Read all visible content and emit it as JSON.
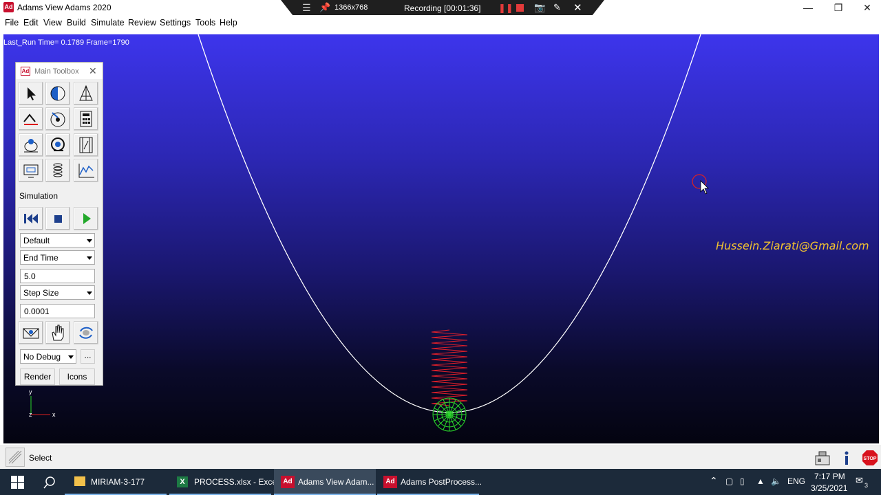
{
  "window": {
    "title": "Adams View Adams 2020",
    "app_icon": "Ad",
    "controls": [
      "minimize-icon",
      "restore-icon",
      "close-icon"
    ]
  },
  "recorder": {
    "resolution": "1366x768",
    "status": "Recording [00:01:36]"
  },
  "menu": [
    "File",
    "Edit",
    "View",
    "Build",
    "Simulate",
    "Review",
    "Settings",
    "Tools",
    "Help"
  ],
  "viewport": {
    "run_info": "Last_Run   Time= 0.1789  Frame=1790",
    "watermark": "Hussein.Ziarati@Gmail.com",
    "axis_y": "y",
    "axis_x": "x",
    "axis_z": "z",
    "colors": {
      "track": "#ffffff",
      "spring": "#e0202a",
      "ball": "#2ad82a",
      "bg_top": "#3d35ec",
      "bg_bottom": "#040410"
    }
  },
  "toolbox": {
    "title": "Main Toolbox",
    "app_icon": "Ad",
    "tools": [
      "select-arrow-icon",
      "rendering-sphere-icon",
      "part-geometry-icon",
      "joint-icon",
      "orient-view-icon",
      "calculator-icon",
      "force-icon",
      "display-settings-icon",
      "animation-film-icon",
      "monitor-icon",
      "spring-icon",
      "plot-icon"
    ],
    "simulation_label": "Simulation",
    "sim_buttons": [
      "reset-icon",
      "stop-icon",
      "play-icon"
    ],
    "sim_setting": "Default",
    "end_mode": "End Time",
    "end_value": "5.0",
    "step_mode": "Step Size",
    "step_value": "0.0001",
    "view_tools": [
      "fit-view-icon",
      "pan-hand-icon",
      "rotate-view-icon"
    ],
    "debug": "No Debug",
    "more": "...",
    "render_label": "Render",
    "icons_label": "Icons"
  },
  "status": {
    "text": "Select",
    "right_icons": [
      "toolbox-icon",
      "info-icon",
      "stop-sign-icon"
    ],
    "stop_text": "STOP"
  },
  "taskbar": {
    "items": [
      {
        "label": "MIRIAM-3-177",
        "icon": "folder-icon"
      },
      {
        "label": "PROCESS.xlsx - Excel",
        "icon": "excel-icon"
      },
      {
        "label": "Adams View Adam...",
        "icon": "adams-icon"
      },
      {
        "label": "Adams PostProcess...",
        "icon": "adams-icon"
      }
    ],
    "language": "ENG",
    "time": "7:17 PM",
    "date": "3/25/2021",
    "notification_count": "3"
  }
}
